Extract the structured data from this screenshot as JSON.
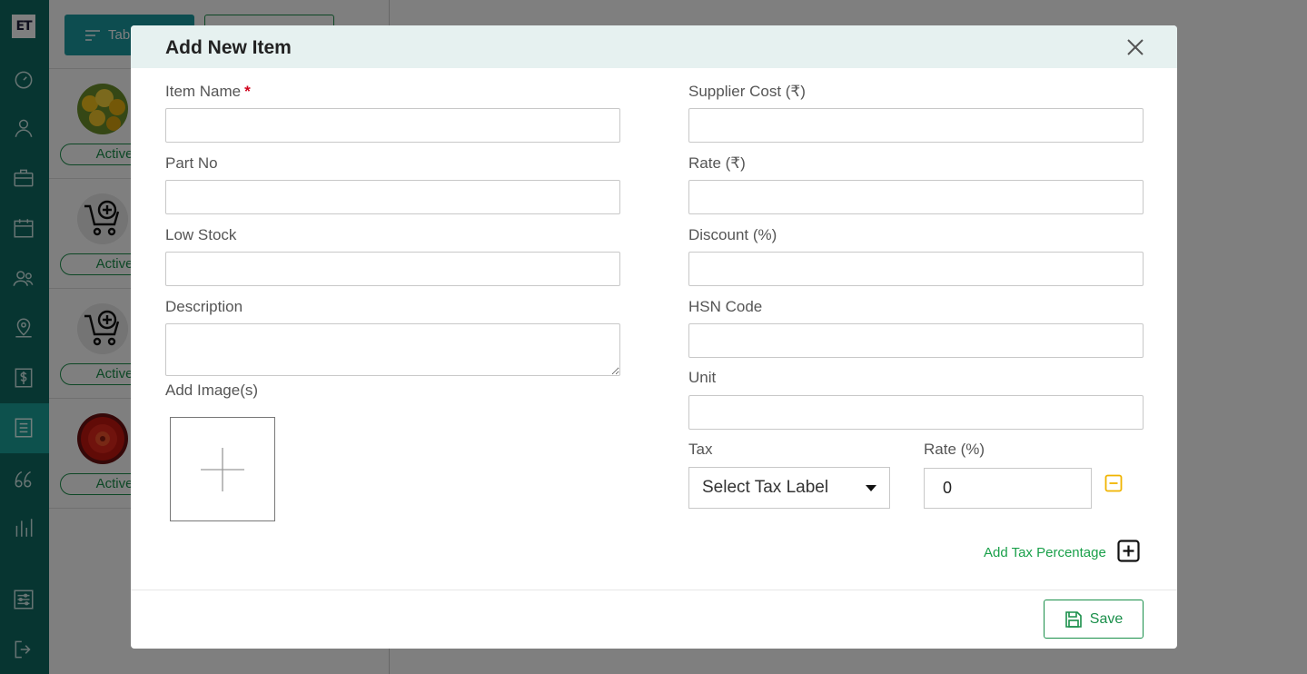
{
  "app": {
    "logo_text": "ET",
    "toolbar": {
      "primary_label": "Tab"
    },
    "list_items": [
      {
        "status": "Active",
        "thumb": "yellow-flowers"
      },
      {
        "status": "Active",
        "thumb": "add-to-cart"
      },
      {
        "status": "Active",
        "thumb": "add-to-cart"
      },
      {
        "status": "Active",
        "thumb": "red-flower"
      }
    ]
  },
  "modal": {
    "title": "Add New Item",
    "left_fields": {
      "item_name_label": "Item Name",
      "item_name_required": "*",
      "item_name_value": "",
      "part_no_label": "Part No",
      "part_no_value": "",
      "low_stock_label": "Low Stock",
      "low_stock_value": "",
      "description_label": "Description",
      "description_value": "",
      "add_images_label": "Add Image(s)"
    },
    "right_fields": {
      "supplier_cost_label": "Supplier Cost (₹)",
      "supplier_cost_value": "",
      "rate_label": "Rate (₹)",
      "rate_value": "",
      "discount_label": "Discount (%)",
      "discount_value": "",
      "hsn_label": "HSN Code",
      "hsn_value": "",
      "unit_label": "Unit",
      "unit_value": ""
    },
    "tax": {
      "tax_label": "Tax",
      "tax_select_value": "Select Tax Label",
      "rate_label": "Rate (%)",
      "rate_value": "0",
      "add_tax_label": "Add Tax Percentage"
    },
    "save_label": "Save"
  },
  "colors": {
    "sidebar": "#0f6b63",
    "accent_green": "#1a8f4a",
    "link_green": "#1aa04a",
    "warning_yellow": "#f0b400",
    "header_bg": "#e6f1f0"
  }
}
